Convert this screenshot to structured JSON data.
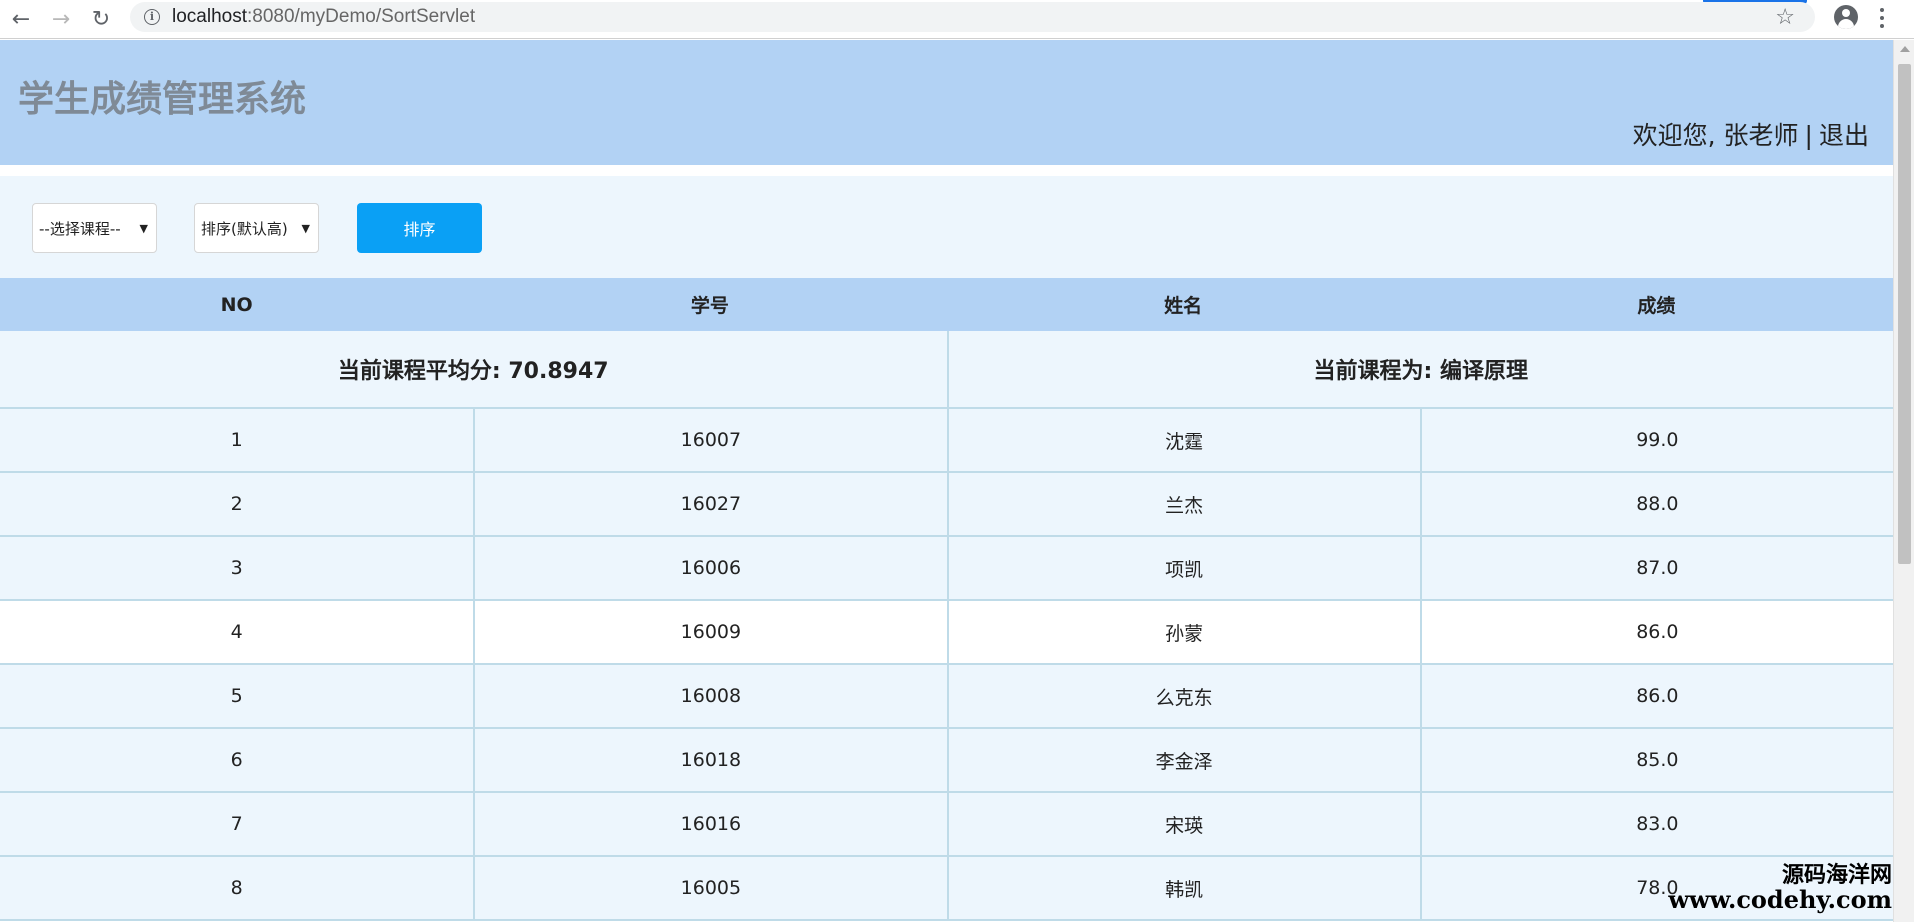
{
  "browser": {
    "url_host": "localhost",
    "url_path": ":8080/myDemo/SortServlet"
  },
  "header": {
    "title": "学生成绩管理系统",
    "welcome_text": "欢迎您, 张老师",
    "separator": "|",
    "logout_label": "退出"
  },
  "toolbar": {
    "course_select_value": "--选择课程--",
    "order_select_value": "排序(默认高)",
    "sort_button_label": "排序"
  },
  "table": {
    "headers": [
      "NO",
      "学号",
      "姓名",
      "成绩"
    ],
    "average_text": "当前课程平均分: 70.8947",
    "course_text": "当前课程为: 编译原理",
    "rows": [
      {
        "no": "1",
        "id": "16007",
        "name": "沈霆",
        "score": "99.0"
      },
      {
        "no": "2",
        "id": "16027",
        "name": "兰杰",
        "score": "88.0"
      },
      {
        "no": "3",
        "id": "16006",
        "name": "项凯",
        "score": "87.0"
      },
      {
        "no": "4",
        "id": "16009",
        "name": "孙蒙",
        "score": "86.0"
      },
      {
        "no": "5",
        "id": "16008",
        "name": "么克东",
        "score": "86.0"
      },
      {
        "no": "6",
        "id": "16018",
        "name": "李金泽",
        "score": "85.0"
      },
      {
        "no": "7",
        "id": "16016",
        "name": "宋瑛",
        "score": "83.0"
      },
      {
        "no": "8",
        "id": "16005",
        "name": "韩凯",
        "score": "78.0"
      }
    ]
  },
  "watermark": {
    "cn": "源码海洋网",
    "en": "www.codehy.com"
  }
}
